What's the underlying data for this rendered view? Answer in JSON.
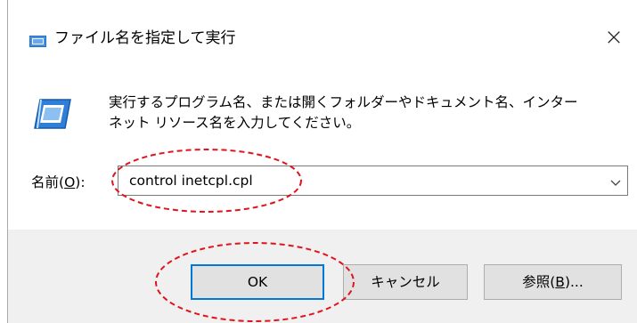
{
  "window": {
    "title": "ファイル名を指定して実行",
    "close_glyph": "×"
  },
  "description": {
    "line1": "実行するプログラム名、または開くフォルダーやドキュメント名、インター",
    "line2": "ネット リソース名を入力してください。"
  },
  "name_field": {
    "label_prefix": "名前(",
    "label_accel": "O",
    "label_suffix": "):",
    "value": "control inetcpl.cpl"
  },
  "buttons": {
    "ok": "OK",
    "cancel": "キャンセル",
    "browse_prefix": "参照(",
    "browse_accel": "B",
    "browse_suffix": ")..."
  },
  "icons": {
    "title": "run-dialog-icon",
    "main": "run-program-icon",
    "dropdown": "chevron-down-icon"
  },
  "colors": {
    "annotation": "#e0141e",
    "footer_bg": "#f0f0f0",
    "default_button_border": "#0078d7",
    "icon_blue": "#1e6fd0"
  }
}
